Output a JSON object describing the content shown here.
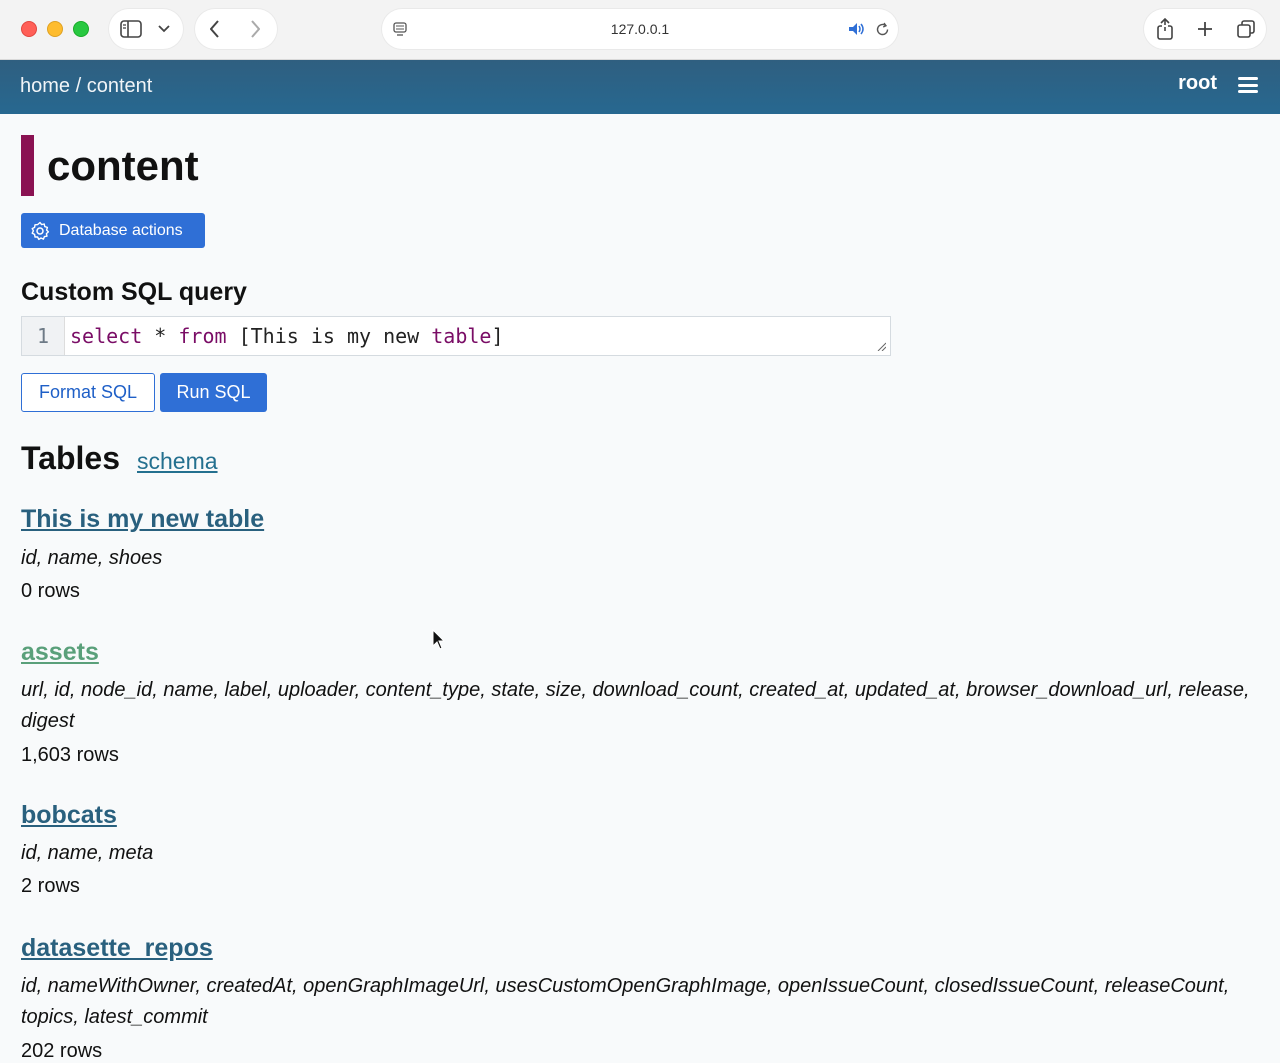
{
  "browser": {
    "url": "127.0.0.1"
  },
  "header": {
    "breadcrumb_home": "home",
    "breadcrumb_sep": "/",
    "breadcrumb_current": "content",
    "actor": "root"
  },
  "page": {
    "title": "content",
    "database_actions": "Database actions",
    "accent_color": "#8a1252"
  },
  "sql": {
    "heading": "Custom SQL query",
    "line_number": "1",
    "kw_select": "select",
    "star": " * ",
    "kw_from": "from",
    "rest": " [This is my new ",
    "kw_table": "table",
    "end": "]",
    "format_button": "Format SQL",
    "run_button": "Run SQL"
  },
  "tables_section": {
    "heading": "Tables",
    "schema_link": "schema",
    "tables": [
      {
        "name": "This is my new table",
        "columns": "id, name, shoes",
        "rows": "0 rows"
      },
      {
        "name": "assets",
        "columns": "url, id, node_id, name, label, uploader, content_type, state, size, download_count, created_at, updated_at, browser_download_url, release, digest",
        "rows": "1,603 rows"
      },
      {
        "name": "bobcats",
        "columns": "id, name, meta",
        "rows": "2 rows"
      },
      {
        "name": "datasette_repos",
        "columns": "id, nameWithOwner, createdAt, openGraphImageUrl, usesCustomOpenGraphImage, openIssueCount, closedIssueCount, releaseCount, topics, latest_commit",
        "rows": "202 rows"
      }
    ]
  }
}
